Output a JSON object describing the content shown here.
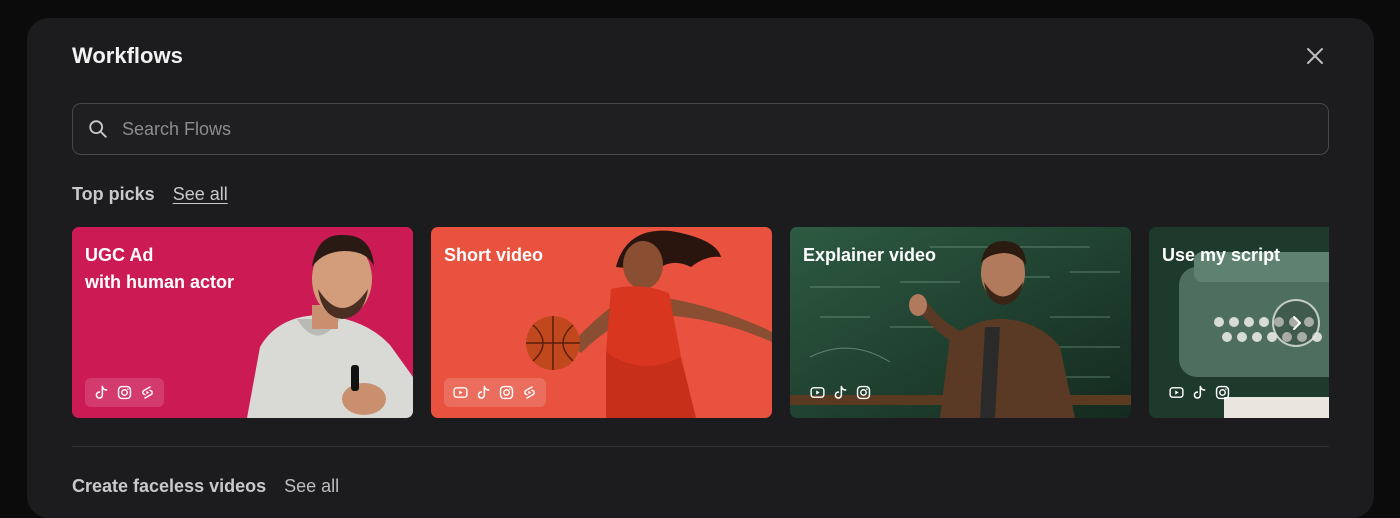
{
  "modal": {
    "title": "Workflows"
  },
  "search": {
    "placeholder": "Search Flows",
    "value": ""
  },
  "top_picks": {
    "label": "Top picks",
    "see_all": "See all",
    "cards": [
      {
        "title_line1": "UGC Ad",
        "title_line2": "with human actor",
        "platforms": [
          "tiktok-icon",
          "instagram-icon",
          "shorts-icon"
        ],
        "bg": "#cc1a55"
      },
      {
        "title_line1": "Short video",
        "title_line2": "",
        "platforms": [
          "youtube-icon",
          "tiktok-icon",
          "instagram-icon",
          "shorts-icon"
        ],
        "bg": "#e8523e"
      },
      {
        "title_line1": "Explainer video",
        "title_line2": "",
        "platforms": [
          "youtube-icon",
          "tiktok-icon",
          "instagram-icon"
        ],
        "bg": "#1f3d2e"
      },
      {
        "title_line1": "Use my script",
        "title_line2": "",
        "platforms": [
          "youtube-icon",
          "tiktok-icon",
          "instagram-icon"
        ],
        "bg": "#1e3a2c"
      }
    ]
  },
  "faceless": {
    "label": "Create faceless videos",
    "see_all": "See all"
  }
}
